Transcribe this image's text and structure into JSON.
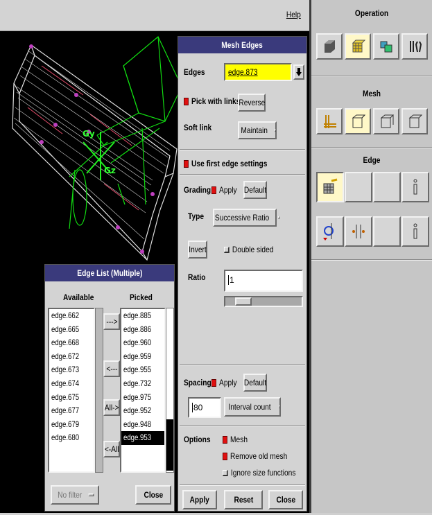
{
  "menubar": {
    "help": "Help"
  },
  "operation": {
    "title": "Operation"
  },
  "mesh_section": {
    "title": "Mesh"
  },
  "edge_section": {
    "title": "Edge"
  },
  "viewport": {
    "axis_y": "Gy",
    "axis_z": "Gz"
  },
  "mesh_edges": {
    "title": "Mesh Edges",
    "edges_label": "Edges",
    "edges_value": "edge.873",
    "pick_with_links": "Pick with links",
    "reverse": "Reverse",
    "soft_link_label": "Soft link",
    "soft_link_value": "Maintain",
    "use_first_edge": "Use first edge settings",
    "grading_label": "Grading",
    "apply": "Apply",
    "default": "Default",
    "type_label": "Type",
    "type_value": "Successive Ratio",
    "invert": "Invert",
    "double_sided": "Double sided",
    "ratio_label": "Ratio",
    "ratio_value": "1",
    "spacing_label": "Spacing",
    "spacing_apply": "Apply",
    "spacing_default": "Default",
    "spacing_value": "80",
    "spacing_type": "Interval count",
    "options_label": "Options",
    "opt_mesh": "Mesh",
    "opt_remove_old": "Remove old mesh",
    "opt_ignore_size": "Ignore size functions",
    "apply_btn": "Apply",
    "reset_btn": "Reset",
    "close_btn": "Close"
  },
  "edge_list": {
    "title": "Edge List (Multiple)",
    "available_header": "Available",
    "picked_header": "Picked",
    "available": [
      "edge.662",
      "edge.665",
      "edge.668",
      "edge.672",
      "edge.673",
      "edge.674",
      "edge.675",
      "edge.677",
      "edge.679",
      "edge.680"
    ],
    "picked": [
      "edge.885",
      "edge.886",
      "edge.960",
      "edge.959",
      "edge.955",
      "edge.732",
      "edge.975",
      "edge.952",
      "edge.948",
      "edge.953"
    ],
    "move_right": "--->",
    "move_left": "<---",
    "all_right": "All->",
    "all_left": "<-All",
    "filter": "No filter",
    "close": "Close"
  }
}
